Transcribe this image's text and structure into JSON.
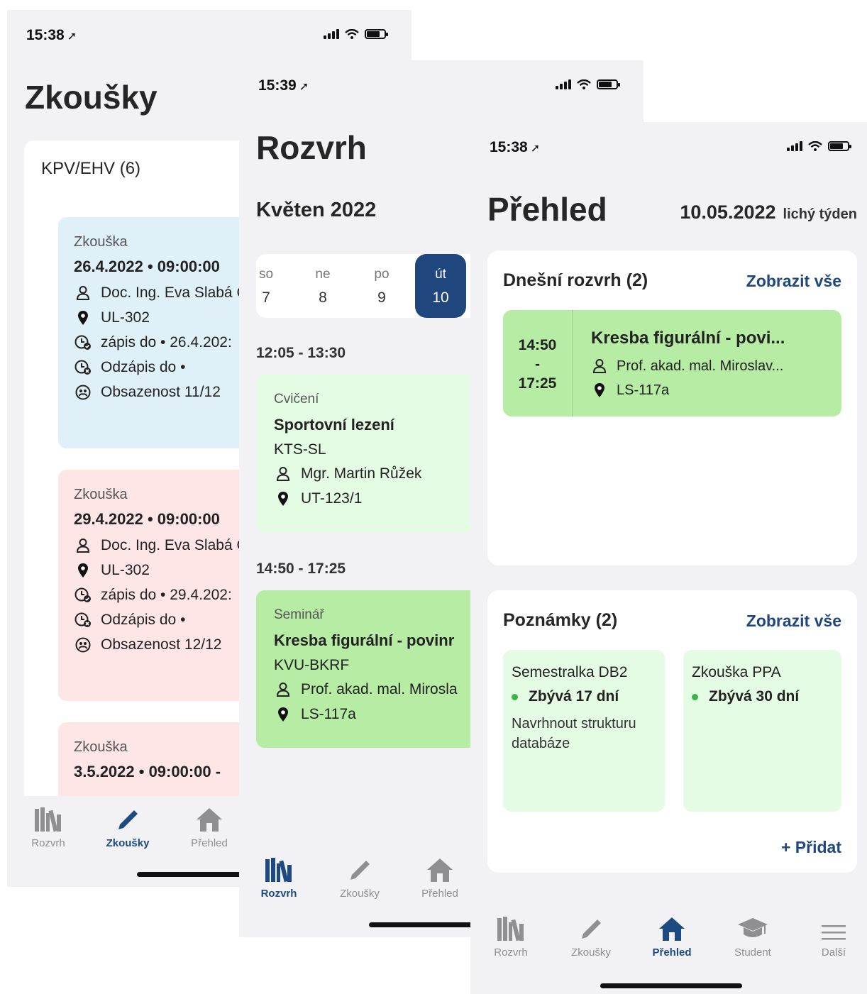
{
  "screens": {
    "exams": {
      "status_time": "15:38",
      "title": "Zkoušky",
      "course": "KPV/EHV (6)",
      "items": [
        {
          "type": "Zkouška",
          "datetime": "26.4.2022 • 09:00:00",
          "teacher": "Doc. Ing. Eva Slabá C",
          "room": "UL-302",
          "enroll": "zápis do • 26.4.202:",
          "unenroll": "Odzápis do •",
          "capacity": "Obsazenost 11/12",
          "color": "#dff0f8"
        },
        {
          "type": "Zkouška",
          "datetime": "29.4.2022 • 09:00:00",
          "teacher": "Doc. Ing. Eva Slabá C",
          "room": "UL-302",
          "enroll": "zápis do • 29.4.202:",
          "unenroll": "Odzápis do •",
          "capacity": "Obsazenost 12/12",
          "color": "#fde6e5"
        },
        {
          "type": "Zkouška",
          "datetime": "3.5.2022 • 09:00:00 -",
          "color": "#fde6e5"
        }
      ],
      "tabs": [
        {
          "label": "Rozvrh",
          "icon": "books-icon"
        },
        {
          "label": "Zkoušky",
          "icon": "pencil-icon"
        },
        {
          "label": "Přehled",
          "icon": "home-icon"
        }
      ]
    },
    "schedule": {
      "status_time": "15:39",
      "title": "Rozvrh",
      "month": "Květen 2022",
      "days": [
        {
          "name": "so",
          "num": "7"
        },
        {
          "name": "ne",
          "num": "8"
        },
        {
          "name": "po",
          "num": "9"
        },
        {
          "name": "út",
          "num": "10"
        }
      ],
      "blocks": [
        {
          "time": "12:05 - 13:30",
          "type": "Cvičení",
          "title": "Sportovní lezení",
          "code": "KTS-SL",
          "teacher": "Mgr. Martin Růžek",
          "room": "UT-123/1"
        },
        {
          "time": "14:50 - 17:25",
          "type": "Seminář",
          "title": "Kresba figurální - povinr",
          "code": "KVU-BKRF",
          "teacher": "Prof. akad. mal. Mirosla",
          "room": "LS-117a"
        }
      ],
      "tabs": [
        {
          "label": "Rozvrh",
          "icon": "books-icon"
        },
        {
          "label": "Zkoušky",
          "icon": "pencil-icon"
        },
        {
          "label": "Přehled",
          "icon": "home-icon"
        }
      ]
    },
    "overview": {
      "status_time": "15:38",
      "title": "Přehled",
      "date": "10.05.2022",
      "week": "lichý týden",
      "today": {
        "title": "Dnešní rozvrh (2)",
        "link": "Zobrazit vše",
        "item": {
          "time_from": "14:50",
          "dash": "-",
          "time_to": "17:25",
          "title": "Kresba figurální - povi...",
          "teacher": "Prof. akad. mal. Miroslav...",
          "room": "LS-117a"
        }
      },
      "notes": {
        "title": "Poznámky (2)",
        "link": "Zobrazit vše",
        "items": [
          {
            "title": "Semestralka DB2",
            "left": "Zbývá 17 dní",
            "text": "Navrhnout strukturu databáze"
          },
          {
            "title": "Zkouška PPA",
            "left": "Zbývá 30 dní",
            "text": ""
          }
        ],
        "add": "+ Přidat"
      },
      "tabs": [
        {
          "label": "Rozvrh",
          "icon": "books-icon"
        },
        {
          "label": "Zkoušky",
          "icon": "pencil-icon"
        },
        {
          "label": "Přehled",
          "icon": "home-icon"
        },
        {
          "label": "Student",
          "icon": "graduation-cap-icon"
        },
        {
          "label": "Další",
          "icon": "menu-icon"
        }
      ]
    }
  },
  "colors": {
    "accent": "#1f477e",
    "inactive": "#8e8e93",
    "lesson_green": "#b6eca3",
    "lesson_light": "#e4fbe4",
    "exam_blue": "#dff0f8",
    "exam_pink": "#fde6e5",
    "dot_green": "#39b54a"
  }
}
